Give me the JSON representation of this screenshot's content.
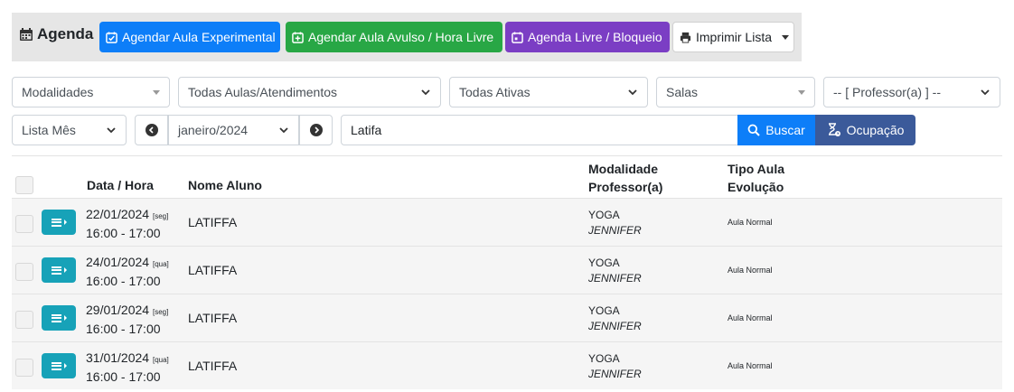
{
  "header": {
    "title": "Agenda",
    "buttons": {
      "experimental": "Agendar Aula Experimental",
      "avulso": "Agendar Aula Avulso / Hora Livre",
      "livre": "Agenda Livre / Bloqueio",
      "imprimir": "Imprimir Lista"
    }
  },
  "filters": {
    "modalidades": "Modalidades",
    "aulas": "Todas Aulas/Atendimentos",
    "ativas": "Todas Ativas",
    "salas": "Salas",
    "professor": "-- [ Professor(a) ] --",
    "lista": "Lista Mês",
    "mes": "janeiro/2024",
    "search_value": "Latifa",
    "buscar": "Buscar",
    "ocupacao": "Ocupação"
  },
  "table": {
    "headers": {
      "data_hora": "Data / Hora",
      "nome": "Nome Aluno",
      "modalidade": "Modalidade",
      "professor": "Professor(a)",
      "tipo": "Tipo Aula",
      "evolucao": "Evolução"
    },
    "rows": [
      {
        "date": "22/01/2024",
        "day": "[seg]",
        "time": "16:00 - 17:00",
        "name": "LATIFFA",
        "modalidade": "YOGA",
        "professor": "JENNIFER",
        "tipo": "Aula Normal"
      },
      {
        "date": "24/01/2024",
        "day": "[qua]",
        "time": "16:00 - 17:00",
        "name": "LATIFFA",
        "modalidade": "YOGA",
        "professor": "JENNIFER",
        "tipo": "Aula Normal"
      },
      {
        "date": "29/01/2024",
        "day": "[seg]",
        "time": "16:00 - 17:00",
        "name": "LATIFFA",
        "modalidade": "YOGA",
        "professor": "JENNIFER",
        "tipo": "Aula Normal"
      },
      {
        "date": "31/01/2024",
        "day": "[qua]",
        "time": "16:00 - 17:00",
        "name": "LATIFFA",
        "modalidade": "YOGA",
        "professor": "JENNIFER",
        "tipo": "Aula Normal"
      }
    ]
  },
  "colors": {
    "blue": "#0d7ef8",
    "green": "#28a745",
    "purple": "#7b3ec4",
    "teal": "#17a2b8",
    "navy": "#3b5a9a"
  },
  "icons": [
    "calendar-icon",
    "calendar-check-icon",
    "calendar-plus-icon",
    "calendar-icon",
    "printer-icon",
    "search-icon",
    "hourglass-icon",
    "menu-icon"
  ]
}
